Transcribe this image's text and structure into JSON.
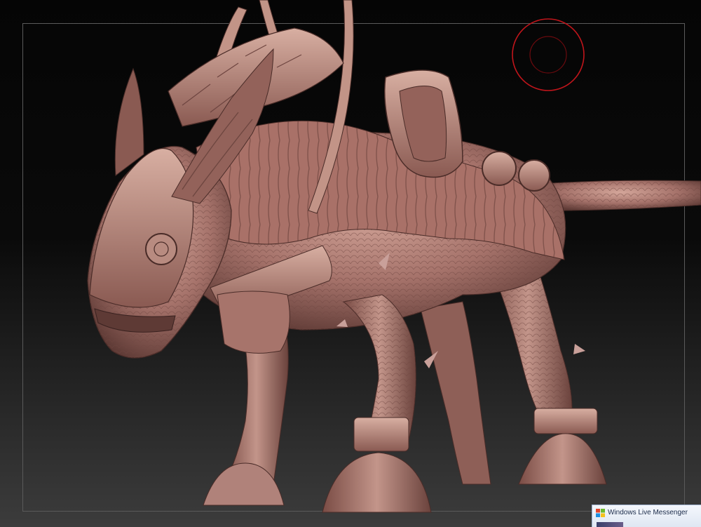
{
  "viewport": {
    "background_top": "#050505",
    "background_bottom": "#3c3c3c",
    "frame_color": "#5a5a5a"
  },
  "brush_cursor": {
    "icon": "brush-cursor-icon",
    "color": "#c0151b"
  },
  "model": {
    "icon": "armored-creature-sculpt",
    "material_color": "#b07c72"
  },
  "notification": {
    "title": "Windows Live Messenger",
    "icon": "windows-flag-icon"
  }
}
